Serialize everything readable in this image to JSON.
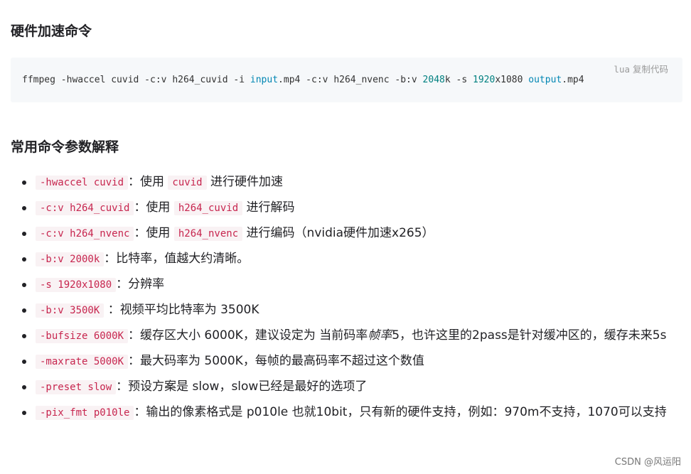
{
  "headings": {
    "hardware_accel": "硬件加速命令",
    "params_explained": "常用命令参数解释"
  },
  "code_block": {
    "lang": "lua",
    "copy_label": "复制代码",
    "tokens": {
      "t1": "ffmpeg -hwaccel cuvid -c:v h264_cuvid -i ",
      "t2": "input",
      "t3": ".mp4 -c:v h264_nvenc -b:v ",
      "t4": "2048",
      "t5": "k -s ",
      "t6": "1920",
      "t7": "x1080 ",
      "t8": "output",
      "t9": ".mp4"
    }
  },
  "params": [
    {
      "code": "-hwaccel cuvid",
      "sep": "：使用 ",
      "code2": "cuvid",
      "text": " 进行硬件加速"
    },
    {
      "code": "-c:v h264_cuvid",
      "sep": "：使用 ",
      "code2": "h264_cuvid",
      "text": " 进行解码"
    },
    {
      "code": "-c:v h264_nvenc",
      "sep": "：使用 ",
      "code2": "h264_nvenc",
      "text": " 进行编码（nvidia硬件加速x265）"
    },
    {
      "code": "-b:v 2000k",
      "text": "：比特率，值越大约清晰。"
    },
    {
      "code": "-s 1920x1080",
      "text": "：分辨率"
    },
    {
      "code": "-b:v 3500K",
      "text": " ：视频平均比特率为 3500K"
    },
    {
      "code": "-bufsize 6000K",
      "text_a": "：缓存区大小 6000K，建议设定为 当前码率",
      "em": "帧率",
      "text_b": "5，也许这里的2pass是针对缓冲区的，缓存未来5s"
    },
    {
      "code": "-maxrate 5000K",
      "text": "：最大码率为 5000K，每帧的最高码率不超过这个数值"
    },
    {
      "code": "-preset slow",
      "text": "：预设方案是 slow，slow已经是最好的选项了"
    },
    {
      "code": "-pix_fmt p010le",
      "text": "：输出的像素格式是 p010le 也就10bit，只有新的硬件支持，例如：970m不支持，1070可以支持"
    }
  ],
  "watermark": "CSDN @风运阳"
}
